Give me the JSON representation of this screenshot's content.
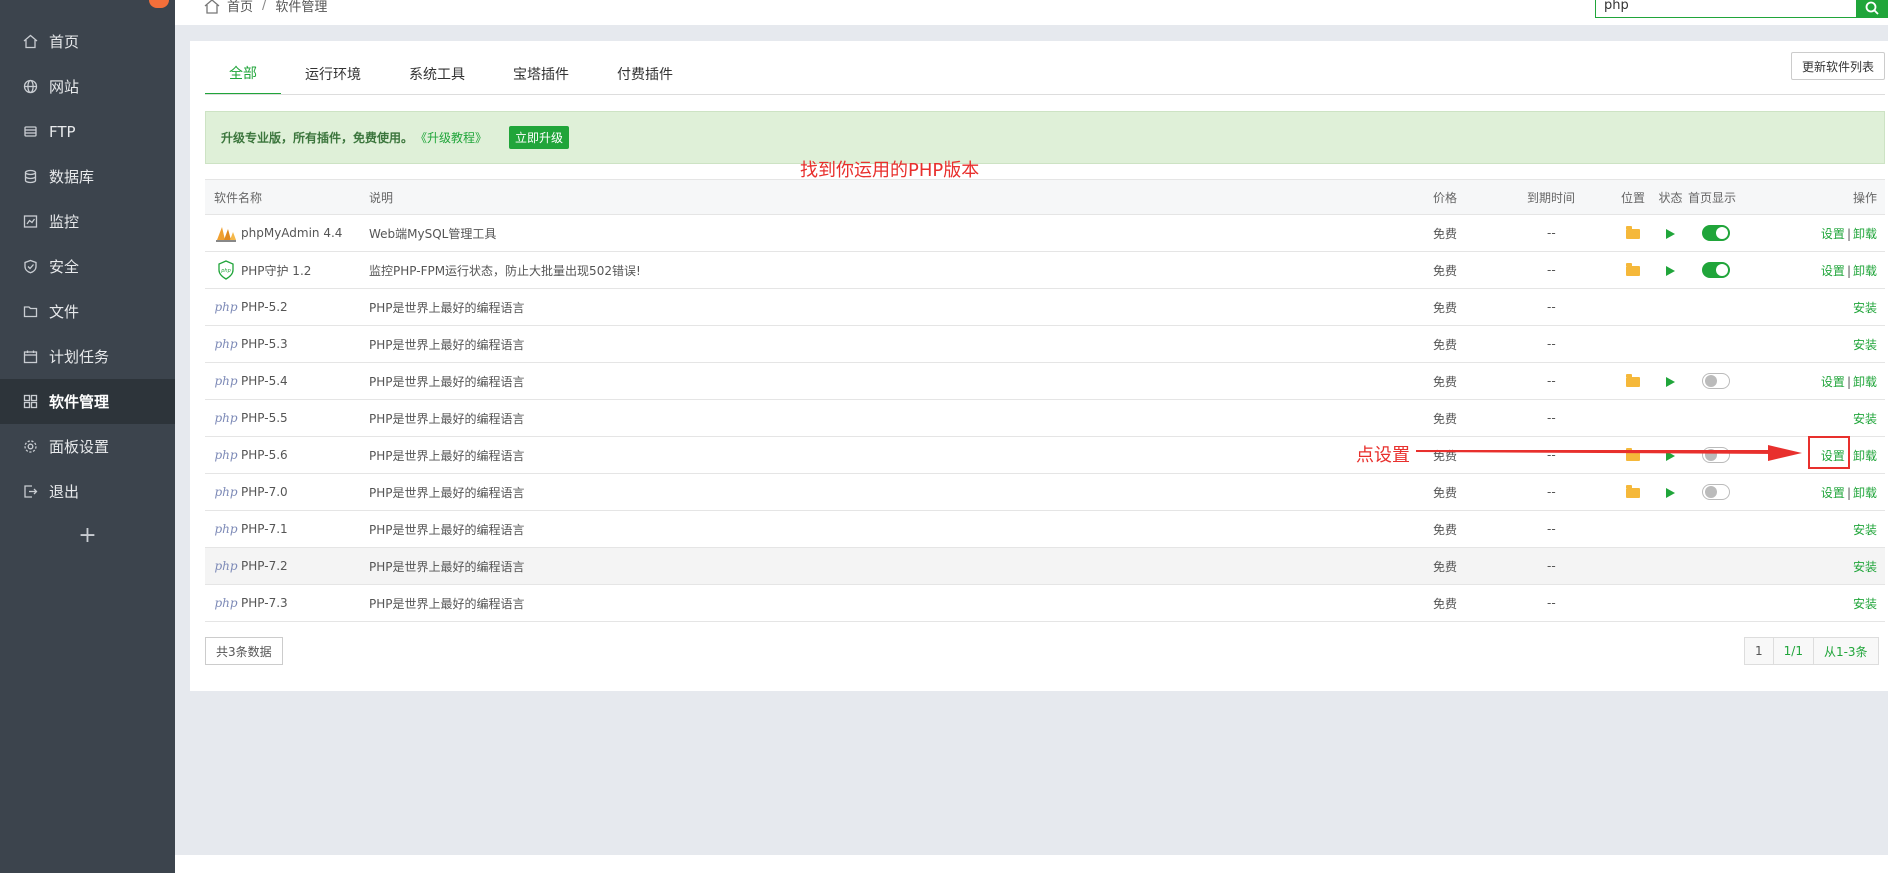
{
  "sidebar": {
    "items": [
      {
        "label": "首页",
        "icon": "home-icon"
      },
      {
        "label": "网站",
        "icon": "globe-icon"
      },
      {
        "label": "FTP",
        "icon": "ftp-icon"
      },
      {
        "label": "数据库",
        "icon": "database-icon"
      },
      {
        "label": "监控",
        "icon": "monitor-icon"
      },
      {
        "label": "安全",
        "icon": "shield-icon"
      },
      {
        "label": "文件",
        "icon": "folder-icon"
      },
      {
        "label": "计划任务",
        "icon": "calendar-icon"
      },
      {
        "label": "软件管理",
        "icon": "grid-icon",
        "active": true
      },
      {
        "label": "面板设置",
        "icon": "gear-icon"
      },
      {
        "label": "退出",
        "icon": "logout-icon"
      }
    ],
    "add_label": "+"
  },
  "breadcrumb": {
    "home": "首页",
    "current": "软件管理"
  },
  "search": {
    "value": "php"
  },
  "tabs": [
    "全部",
    "运行环境",
    "系统工具",
    "宝塔插件",
    "付费插件"
  ],
  "refresh_label": "更新软件列表",
  "notice": {
    "text": "升级专业版，所有插件，免费使用。",
    "link": "《升级教程》",
    "button": "立即升级"
  },
  "annotations": {
    "top": "找到你运用的PHP版本",
    "settings": "点设置"
  },
  "table": {
    "headers": [
      "软件名称",
      "说明",
      "价格",
      "到期时间",
      "位置",
      "状态",
      "首页显示",
      "操作"
    ],
    "rows": [
      {
        "name": "phpMyAdmin 4.4",
        "desc": "Web端MySQL管理工具",
        "price": "免费",
        "expire": "--",
        "installed": true,
        "toggle": "on",
        "ops": [
          "设置",
          "卸载"
        ]
      },
      {
        "name": "PHP守护 1.2",
        "desc": "监控PHP-FPM运行状态，防止大批量出现502错误!",
        "price": "免费",
        "expire": "--",
        "installed": true,
        "toggle": "on",
        "ops": [
          "设置",
          "卸载"
        ]
      },
      {
        "name": "PHP-5.2",
        "desc": "PHP是世界上最好的编程语言",
        "price": "免费",
        "expire": "--",
        "installed": false,
        "ops": [
          "安装"
        ]
      },
      {
        "name": "PHP-5.3",
        "desc": "PHP是世界上最好的编程语言",
        "price": "免费",
        "expire": "--",
        "installed": false,
        "ops": [
          "安装"
        ]
      },
      {
        "name": "PHP-5.4",
        "desc": "PHP是世界上最好的编程语言",
        "price": "免费",
        "expire": "--",
        "installed": true,
        "toggle": "off",
        "ops": [
          "设置",
          "卸载"
        ]
      },
      {
        "name": "PHP-5.5",
        "desc": "PHP是世界上最好的编程语言",
        "price": "免费",
        "expire": "--",
        "installed": false,
        "ops": [
          "安装"
        ]
      },
      {
        "name": "PHP-5.6",
        "desc": "PHP是世界上最好的编程语言",
        "price": "免费",
        "expire": "--",
        "installed": true,
        "toggle": "off",
        "ops": [
          "设置",
          "卸载"
        ]
      },
      {
        "name": "PHP-7.0",
        "desc": "PHP是世界上最好的编程语言",
        "price": "免费",
        "expire": "--",
        "installed": true,
        "toggle": "off",
        "ops": [
          "设置",
          "卸载"
        ]
      },
      {
        "name": "PHP-7.1",
        "desc": "PHP是世界上最好的编程语言",
        "price": "免费",
        "expire": "--",
        "installed": false,
        "ops": [
          "安装"
        ]
      },
      {
        "name": "PHP-7.2",
        "desc": "PHP是世界上最好的编程语言",
        "price": "免费",
        "expire": "--",
        "installed": false,
        "ops": [
          "安装"
        ],
        "highlight": true
      },
      {
        "name": "PHP-7.3",
        "desc": "PHP是世界上最好的编程语言",
        "price": "免费",
        "expire": "--",
        "installed": false,
        "ops": [
          "安装"
        ]
      }
    ]
  },
  "footer": {
    "count": "共3条数据",
    "pager": [
      "1",
      "1/1",
      "从1-3条"
    ]
  },
  "colors": {
    "accent": "#20a53a",
    "sidebar": "#3c444d",
    "annotation": "#e8302d"
  }
}
